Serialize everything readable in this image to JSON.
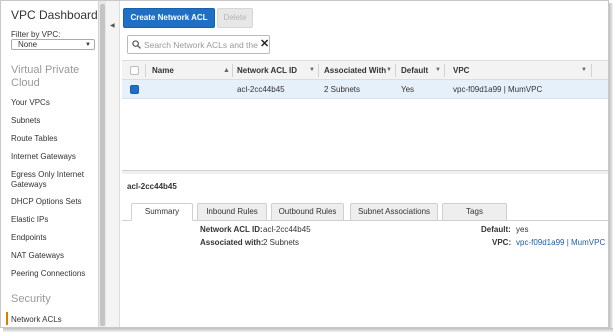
{
  "sidebar": {
    "title": "VPC Dashboard",
    "filter_label": "Filter by VPC:",
    "filter_value": "None",
    "section_vpc": "Virtual Private Cloud",
    "items": [
      {
        "label": "Your VPCs"
      },
      {
        "label": "Subnets"
      },
      {
        "label": "Route Tables"
      },
      {
        "label": "Internet Gateways"
      },
      {
        "label": "Egress Only Internet Gateways"
      },
      {
        "label": "DHCP Options Sets"
      },
      {
        "label": "Elastic IPs"
      },
      {
        "label": "Endpoints"
      },
      {
        "label": "NAT Gateways"
      },
      {
        "label": "Peering Connections"
      }
    ],
    "section_security": "Security",
    "security_items": [
      {
        "label": "Network ACLs",
        "active": true
      }
    ]
  },
  "toolbar": {
    "create_label": "Create Network ACL",
    "delete_label": "Delete"
  },
  "search": {
    "placeholder": "Search Network ACLs and the"
  },
  "table": {
    "columns": [
      "Name",
      "Network ACL ID",
      "Associated With",
      "Default",
      "VPC"
    ],
    "rows": [
      {
        "name": "",
        "id": "acl-2cc44b45",
        "associated": "2 Subnets",
        "default": "Yes",
        "vpc": "vpc-f09d1a99 | MumVPC",
        "selected": true
      }
    ]
  },
  "details": {
    "title": "acl-2cc44b45",
    "tabs": [
      "Summary",
      "Inbound Rules",
      "Outbound Rules",
      "Subnet Associations",
      "Tags"
    ],
    "active_tab": "Summary",
    "fields": {
      "acl_id_label": "Network ACL ID:",
      "acl_id_value": "acl-2cc44b45",
      "associated_label": "Associated with:",
      "associated_value": "2 Subnets",
      "default_label": "Default:",
      "default_value": "yes",
      "vpc_label": "VPC:",
      "vpc_value": "vpc-f09d1a99 | MumVPC"
    }
  },
  "colors": {
    "primary": "#1f6fc5",
    "selected_row": "#e6f0fb",
    "active_marker": "#e07b00",
    "link": "#1f5fa6"
  }
}
